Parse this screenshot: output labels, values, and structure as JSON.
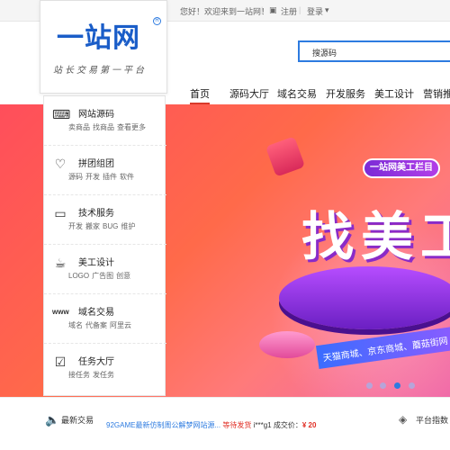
{
  "topbar": {
    "greeting": "您好！欢迎来到一站网！",
    "register": "注册",
    "login": "登录",
    "login_arrow": "▾"
  },
  "logo": {
    "text": "一站网",
    "reg": "R",
    "slogan": "站长交易第一平台"
  },
  "search": {
    "placeholder": "搜源码"
  },
  "nav": {
    "items": [
      {
        "label": "首页"
      },
      {
        "label": "源码大厅"
      },
      {
        "label": "域名交易"
      },
      {
        "label": "开发服务"
      },
      {
        "label": "美工设计"
      },
      {
        "label": "营销推"
      }
    ]
  },
  "sidebar": {
    "items": [
      {
        "title": "网站源码",
        "subs": [
          "卖商品",
          "找商品",
          "查看更多"
        ]
      },
      {
        "title": "拼团组团",
        "subs": [
          "源码",
          "开发",
          "插件",
          "软件"
        ]
      },
      {
        "title": "技术服务",
        "subs": [
          "开发",
          "搬家",
          "BUG",
          "维护"
        ]
      },
      {
        "title": "美工设计",
        "subs": [
          "LOGO",
          "广告图",
          "创意"
        ]
      },
      {
        "title": "域名交易",
        "subs": [
          "域名",
          "代备案",
          "阿里云"
        ]
      },
      {
        "title": "任务大厅",
        "subs": [
          "接任务",
          "发任务"
        ]
      }
    ]
  },
  "banner": {
    "tag": "一站网美工栏目",
    "headline": "找美工",
    "ribbon": "天猫商城、京东商城、蘑菇街网",
    "dots": [
      {
        "active": false
      },
      {
        "active": false
      },
      {
        "active": true
      },
      {
        "active": false
      }
    ]
  },
  "bottom": {
    "label": "最新交易",
    "news_title": "92GAME最新仿制周公解梦网站源...",
    "news_status": "等待发货",
    "news_user": "i***g1",
    "news_price_label": "成交价：",
    "news_price": "¥ 20",
    "platform": "平台指数"
  },
  "colors": {
    "accent": "#2d7be0",
    "red": "#e02e24"
  }
}
